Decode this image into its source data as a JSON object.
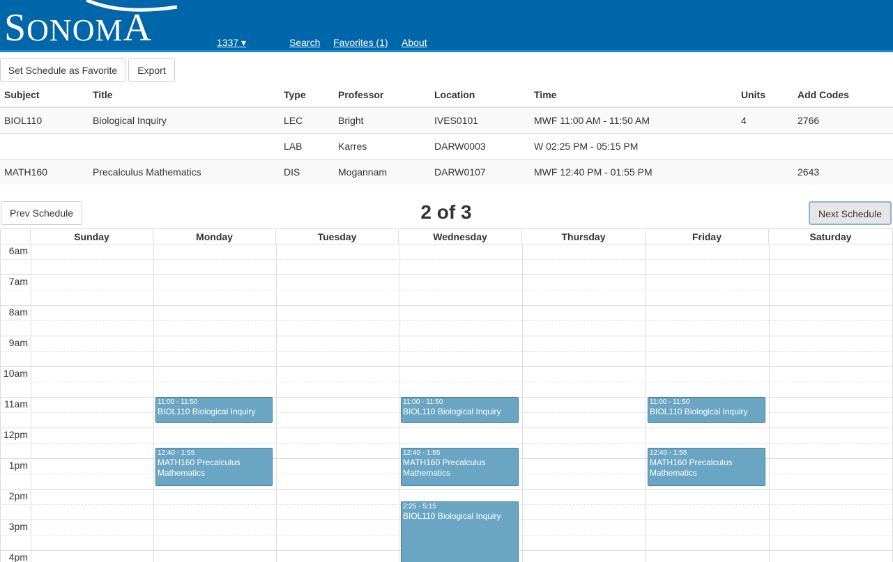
{
  "header": {
    "logo_text_big": "S",
    "logo_text_rest": "ONOM",
    "logo_text_end": "A",
    "term": "1337 ▾",
    "nav": [
      "Search",
      "Favorites (1)",
      "About"
    ]
  },
  "toolbar": {
    "favorite_label": "Set Schedule as Favorite",
    "export_label": "Export"
  },
  "course_table": {
    "columns": [
      "Subject",
      "Title",
      "Type",
      "Professor",
      "Location",
      "Time",
      "Units",
      "Add Codes"
    ],
    "rows": [
      [
        "BIOL110",
        "Biological Inquiry",
        "LEC",
        "Bright",
        "IVES0101",
        "MWF 11:00 AM - 11:50 AM",
        "4",
        "2766"
      ],
      [
        "",
        "",
        "LAB",
        "Karres",
        "DARW0003",
        "W 02:25 PM - 05:15 PM",
        "",
        ""
      ],
      [
        "MATH160",
        "Precalculus Mathematics",
        "DIS",
        "Mogannam",
        "DARW0107",
        "MWF 12:40 PM - 01:55 PM",
        "",
        "2643"
      ]
    ]
  },
  "pager": {
    "prev_label": "Prev Schedule",
    "next_label": "Next Schedule",
    "indicator": "2 of 3"
  },
  "calendar": {
    "days": [
      "Sunday",
      "Monday",
      "Tuesday",
      "Wednesday",
      "Thursday",
      "Friday",
      "Saturday"
    ],
    "hours": [
      "6am",
      "7am",
      "8am",
      "9am",
      "10am",
      "11am",
      "12pm",
      "1pm",
      "2pm",
      "3pm",
      "4pm"
    ],
    "events": [
      {
        "day": 1,
        "time": "11:00 - 11:50",
        "title": "BIOL110 Biological Inquiry",
        "start": 11.0,
        "end": 11.833
      },
      {
        "day": 3,
        "time": "11:00 - 11:50",
        "title": "BIOL110 Biological Inquiry",
        "start": 11.0,
        "end": 11.833
      },
      {
        "day": 5,
        "time": "11:00 - 11:50",
        "title": "BIOL110 Biological Inquiry",
        "start": 11.0,
        "end": 11.833
      },
      {
        "day": 1,
        "time": "12:40 - 1:55",
        "title": "MATH160 Precalculus Mathematics",
        "start": 12.667,
        "end": 13.917
      },
      {
        "day": 3,
        "time": "12:40 - 1:55",
        "title": "MATH160 Precalculus Mathematics",
        "start": 12.667,
        "end": 13.917
      },
      {
        "day": 5,
        "time": "12:40 - 1:55",
        "title": "MATH160 Precalculus Mathematics",
        "start": 12.667,
        "end": 13.917
      },
      {
        "day": 3,
        "time": "2:25 - 5:15",
        "title": "BIOL110 Biological Inquiry",
        "start": 14.417,
        "end": 17.25
      }
    ],
    "event_color": "#6aa6c4"
  },
  "colors": {
    "header_bg": "#0066aa",
    "event_bg": "#6aa6c4"
  }
}
